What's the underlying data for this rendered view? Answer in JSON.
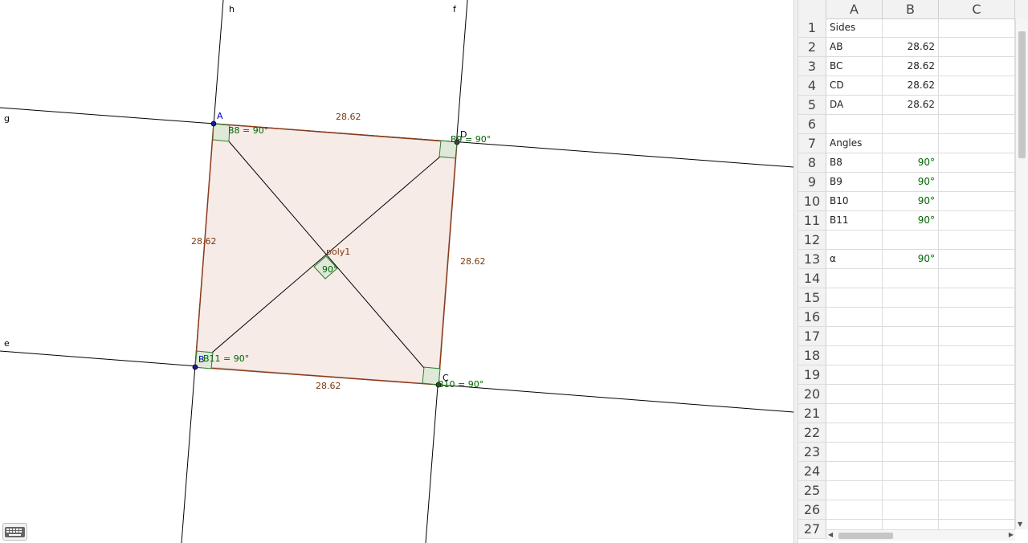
{
  "graphics": {
    "line_labels": {
      "g": "g",
      "h": "h",
      "f": "f",
      "e": "e"
    },
    "point_labels": {
      "A": "A",
      "B": "B",
      "C": "C",
      "D": "D"
    },
    "polygon_label": "poly1",
    "side_lengths": {
      "AB": "28.62",
      "BC": "28.62",
      "CD": "28.62",
      "DA": "28.62"
    },
    "angle_labels": {
      "B8": "B8 = 90°",
      "B9": "B9 = 90°",
      "B10": "B10 = 90°",
      "B11": "B11 = 90°",
      "alpha": "90°"
    },
    "colors": {
      "polygon_fill": "#f5e7e2",
      "polygon_stroke": "#8b3a1a",
      "angle_fill": "#dfe9d8",
      "angle_stroke": "#2e7d32",
      "point": "#1a1a99"
    }
  },
  "keyboard_button": {
    "icon": "keyboard-icon"
  },
  "spreadsheet": {
    "columns": [
      "A",
      "B",
      "C"
    ],
    "rows": [
      {
        "num": "1",
        "a": "Sides",
        "b": "",
        "c": ""
      },
      {
        "num": "2",
        "a": "AB",
        "b": "28.62",
        "c": ""
      },
      {
        "num": "3",
        "a": "BC",
        "b": "28.62",
        "c": ""
      },
      {
        "num": "4",
        "a": "CD",
        "b": "28.62",
        "c": ""
      },
      {
        "num": "5",
        "a": "DA",
        "b": "28.62",
        "c": ""
      },
      {
        "num": "6",
        "a": "",
        "b": "",
        "c": ""
      },
      {
        "num": "7",
        "a": "Angles",
        "b": "",
        "c": ""
      },
      {
        "num": "8",
        "a": "B8",
        "b": "90°",
        "c": ""
      },
      {
        "num": "9",
        "a": "B9",
        "b": "90°",
        "c": ""
      },
      {
        "num": "10",
        "a": "B10",
        "b": "90°",
        "c": ""
      },
      {
        "num": "11",
        "a": "B11",
        "b": "90°",
        "c": ""
      },
      {
        "num": "12",
        "a": "",
        "b": "",
        "c": ""
      },
      {
        "num": "13",
        "a": "α",
        "b": "90°",
        "c": ""
      },
      {
        "num": "14",
        "a": "",
        "b": "",
        "c": ""
      },
      {
        "num": "15",
        "a": "",
        "b": "",
        "c": ""
      },
      {
        "num": "16",
        "a": "",
        "b": "",
        "c": ""
      },
      {
        "num": "17",
        "a": "",
        "b": "",
        "c": ""
      },
      {
        "num": "18",
        "a": "",
        "b": "",
        "c": ""
      },
      {
        "num": "19",
        "a": "",
        "b": "",
        "c": ""
      },
      {
        "num": "20",
        "a": "",
        "b": "",
        "c": ""
      },
      {
        "num": "21",
        "a": "",
        "b": "",
        "c": ""
      },
      {
        "num": "22",
        "a": "",
        "b": "",
        "c": ""
      },
      {
        "num": "23",
        "a": "",
        "b": "",
        "c": ""
      },
      {
        "num": "24",
        "a": "",
        "b": "",
        "c": ""
      },
      {
        "num": "25",
        "a": "",
        "b": "",
        "c": ""
      },
      {
        "num": "26",
        "a": "",
        "b": "",
        "c": ""
      },
      {
        "num": "27",
        "a": "",
        "b": "",
        "c": ""
      }
    ],
    "angle_rows": [
      "8",
      "9",
      "10",
      "11",
      "13"
    ]
  }
}
